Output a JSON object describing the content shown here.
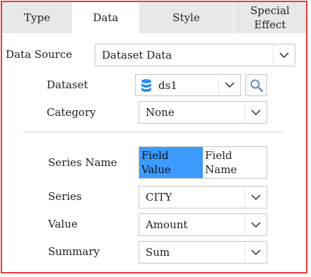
{
  "tabs": [
    {
      "label": "Type"
    },
    {
      "label": "Data"
    },
    {
      "label": "Style"
    },
    {
      "label": "Special\nEffect"
    }
  ],
  "data_source": {
    "label": "Data Source",
    "value": "Dataset Data"
  },
  "dataset": {
    "label": "Dataset",
    "value": "ds1"
  },
  "category": {
    "label": "Category",
    "value": "None"
  },
  "series_name": {
    "label": "Series Name",
    "options": [
      "Field\nValue",
      "Field\nName"
    ]
  },
  "series": {
    "label": "Series",
    "value": "CITY"
  },
  "value": {
    "label": "Value",
    "value": "Amount"
  },
  "summary": {
    "label": "Summary",
    "value": "Sum"
  },
  "colors": {
    "border": "#e8393b",
    "selected": "#3d9bff",
    "db_icon": "#2f8cf0"
  }
}
